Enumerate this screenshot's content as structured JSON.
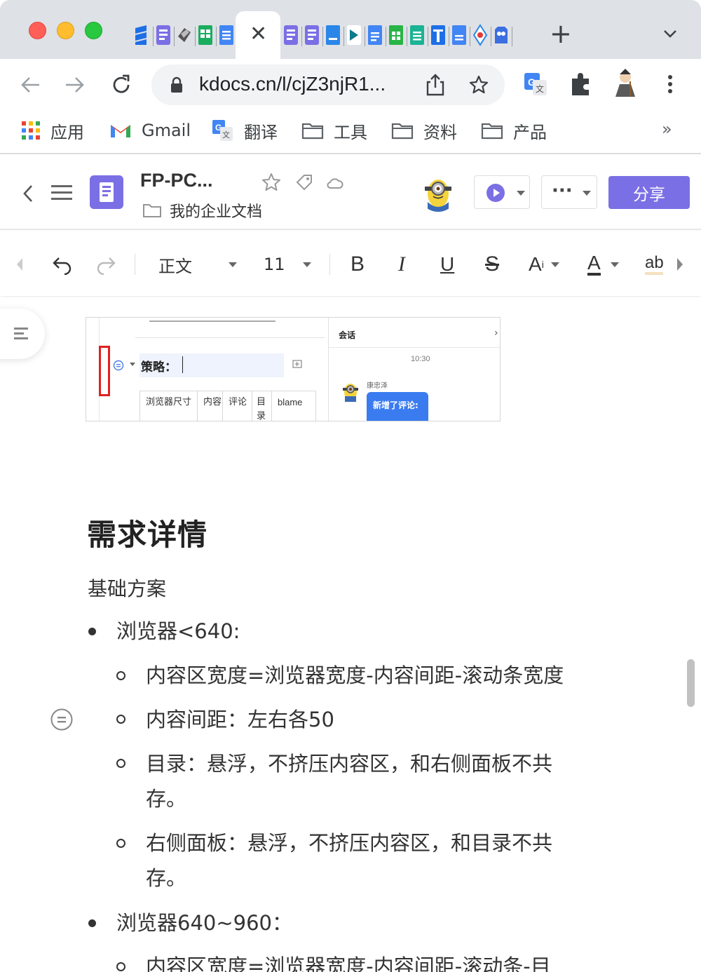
{
  "browser": {
    "tab_close_symbol": "✕",
    "new_tab_symbol": "+",
    "url": "kdocs.cn/l/cjZ3njR1...",
    "bookmarks": [
      {
        "label": "应用",
        "icon": "apps-grid-icon"
      },
      {
        "label": "Gmail",
        "icon": "gmail-icon"
      },
      {
        "label": "翻译",
        "icon": "translate-icon"
      },
      {
        "label": "工具",
        "icon": "folder-icon"
      },
      {
        "label": "资料",
        "icon": "folder-icon"
      },
      {
        "label": "产品",
        "icon": "folder-icon"
      }
    ],
    "bookmarks_more": "»",
    "colors": {
      "tabstrip": "#dee1e6",
      "accent": "#1a73e8"
    }
  },
  "app": {
    "doc_title": "FP-PC...",
    "folder": "我的企业文档",
    "share_label": "分享",
    "more_label": "···",
    "accent_color": "#7b6fe5"
  },
  "toolbar": {
    "style_value": "正文",
    "font_size": "11",
    "bold": "B",
    "italic": "I",
    "underline": "U",
    "strike": "S",
    "superscript": "A",
    "superscript_mark": "i",
    "font_color": "A",
    "highlight": "ab"
  },
  "embed": {
    "strategy_label": "策略：",
    "table_headers": [
      "浏览器尺寸",
      "内容",
      "评论",
      "目录",
      "blame"
    ],
    "panel_title": "会话",
    "time": "10:30",
    "commenter": "康忠泽",
    "bubble_text": "新增了评论:"
  },
  "document": {
    "heading": "需求详情",
    "paragraph": "基础方案",
    "bullets": [
      {
        "text": "浏览器<640:",
        "children": [
          "内容区宽度=浏览器宽度-内容间距-滚动条宽度",
          "内容间距：左右各50",
          "目录：悬浮，不挤压内容区，和右侧面板不共",
          "存。",
          "右侧面板：悬浮，不挤压内容区，和目录不共",
          "存。"
        ]
      },
      {
        "text": "浏览器640~960：",
        "children": [
          "内容区宽度=浏览器宽度-内容间距-滚动条-目"
        ]
      }
    ]
  }
}
